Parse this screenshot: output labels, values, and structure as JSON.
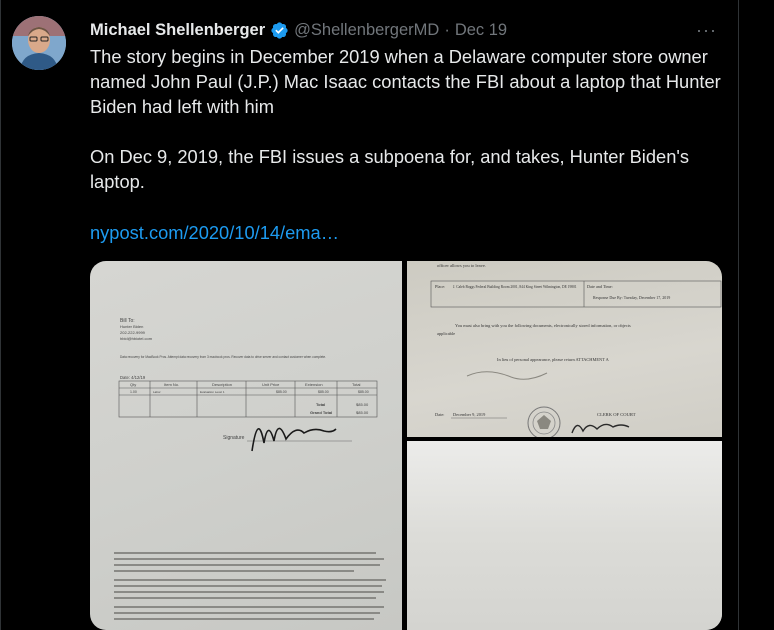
{
  "tweet": {
    "author_name": "Michael Shellenberger",
    "handle": "@ShellenbergerMD",
    "separator": "·",
    "date": "Dec 19",
    "more_label": "···",
    "paragraph_1": "The story begins in December 2019 when a Delaware computer store owner named John Paul (J.P.) Mac Isaac contacts the FBI about a laptop that Hunter Biden had left with him",
    "paragraph_2": "On Dec 9, 2019, the FBI issues a subpoena for, and takes, Hunter Biden's laptop.",
    "link_text": "nypost.com/2020/10/14/ema…"
  },
  "media": {
    "invoice": {
      "bill_to": "Bill To:",
      "name": "Hunter Biden",
      "phone": "202-222-9999",
      "email": "hbid@hbiotel.com",
      "notice": "Data recovery for MacBook Pros. Attempt data recovery from 3 macbook pros. Recover data to drive server and contact customer when complete.",
      "date": "Date: 4/12/19",
      "col_qty": "Qty",
      "col_item": "Item No.",
      "col_desc": "Description",
      "col_unit": "Unit Price",
      "col_ext": "Extension",
      "col_total": "Total",
      "row_qty": "1.00",
      "row_item": "Labor",
      "row_desc": "Evaluation Level 1",
      "row_unit": "$85.00",
      "row_ext": "$85.00",
      "row_total": "$85.00",
      "total_label": "Total",
      "total_value": "$85.00",
      "grand_total_label": "Grand Total",
      "grand_total_value": "$85.00",
      "signature_label": "Signature"
    },
    "subpoena": {
      "top_line": "officer allows you to leave.",
      "place_label": "Place:",
      "place_value": "J. Caleb Boggs Federal Building Room 2001, 844 King Street Wilmington, DE 19801",
      "date_time_label": "Date and Time:",
      "date_time_value": "Response Due By: Tuesday, December 17, 2019",
      "bring_text": "You must also bring with you the following documents, electronically stored information, or objects",
      "bring_text_2": "applicable",
      "in_lieu": "In lieu of personal appearance, please return ATTACHMENT A",
      "date_label": "Date:",
      "date_value": "December 9, 2019",
      "clerk_label": "CLERK OF COURT"
    }
  }
}
